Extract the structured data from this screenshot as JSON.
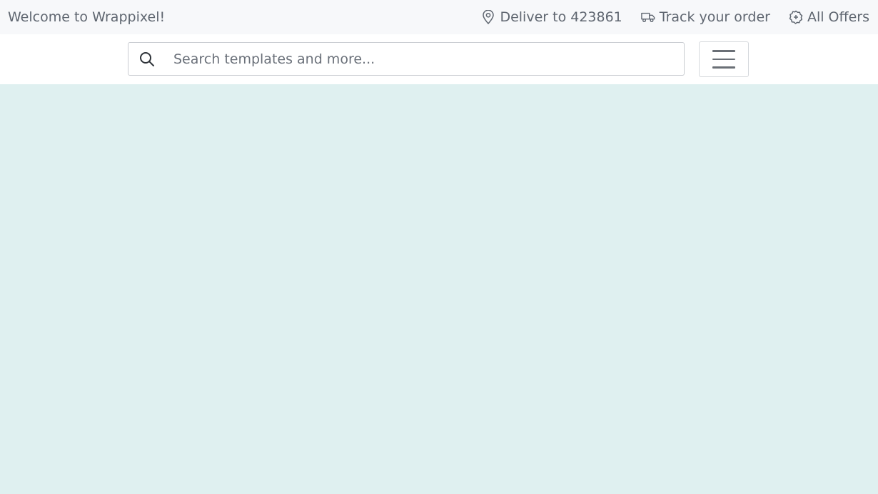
{
  "topbar": {
    "welcome": "Welcome to Wrappixel!",
    "deliver": {
      "label": "Deliver to 423861",
      "icon": "location-pin-icon"
    },
    "track": {
      "label": "Track your order",
      "icon": "truck-icon"
    },
    "offers": {
      "label": "All Offers",
      "icon": "discount-badge-icon"
    }
  },
  "search": {
    "placeholder": "Search templates and more...",
    "value": "",
    "icon": "search-icon"
  },
  "menu": {
    "icon": "hamburger-menu-icon"
  },
  "colors": {
    "topbar_bg": "#f7f8fa",
    "content_bg": "#dff0f0",
    "text": "#5f6670"
  }
}
